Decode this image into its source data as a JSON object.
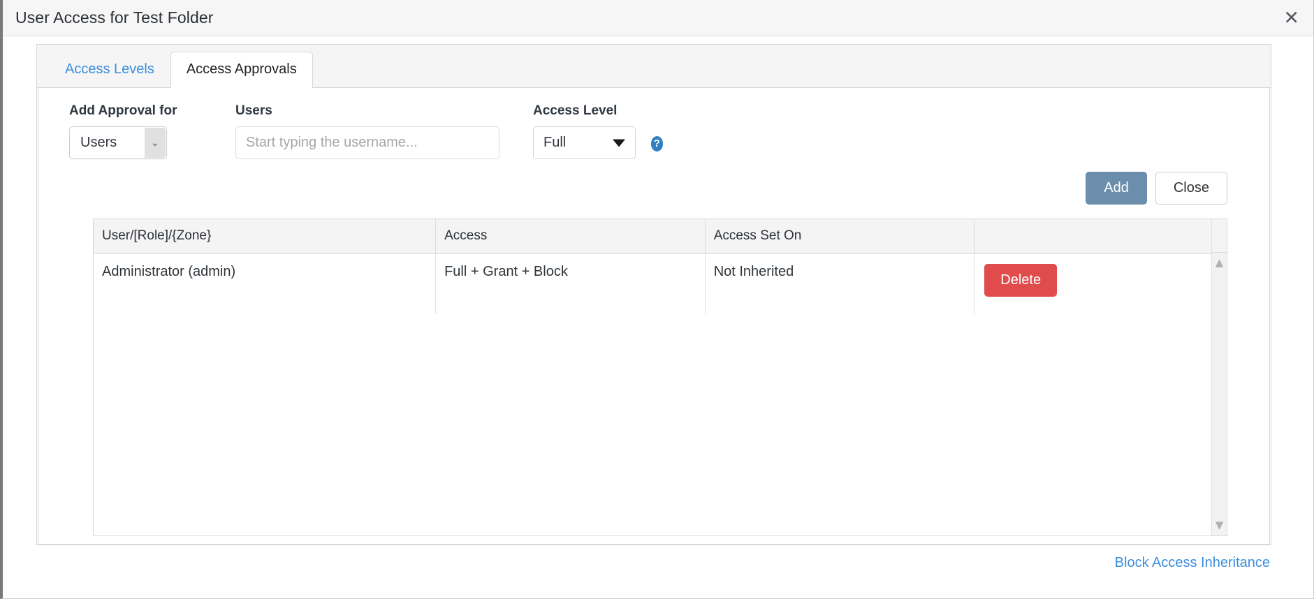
{
  "window": {
    "title": "User Access for Test Folder",
    "close_icon": "close-x-icon"
  },
  "tabs": [
    {
      "label": "Access Levels",
      "active": false
    },
    {
      "label": "Access Approvals",
      "active": true
    }
  ],
  "form": {
    "approval_for": {
      "label": "Add Approval for",
      "value": "Users",
      "options": [
        "Users"
      ]
    },
    "users": {
      "label": "Users",
      "value": "",
      "placeholder": "Start typing the username..."
    },
    "access_level": {
      "label": "Access Level",
      "value": "Full",
      "options": [
        "Full"
      ],
      "help_icon": "question-mark-icon"
    }
  },
  "buttons": {
    "add": "Add",
    "close": "Close"
  },
  "table": {
    "columns": [
      "User/[Role]/{Zone}",
      "Access",
      "Access Set On",
      ""
    ],
    "rows": [
      {
        "user": "Administrator (admin)",
        "access": "Full + Grant + Block",
        "access_set_on": "Not Inherited",
        "action": "Delete"
      }
    ],
    "scrollbar": {
      "up_arrow": "chevron-up-icon",
      "down_arrow": "chevron-down-icon"
    }
  },
  "footer": {
    "link": "Block Access Inheritance"
  },
  "colors": {
    "add_button": "#6c8ead",
    "delete_button": "#e04c4c",
    "link": "#3c8dde",
    "help_icon": "#2f7fc4",
    "header_bg": "#f4f4f4"
  }
}
